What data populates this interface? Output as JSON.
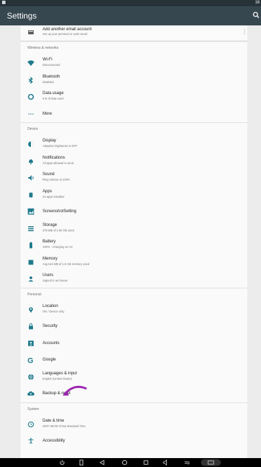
{
  "statusbar": {
    "time": "16"
  },
  "appbar": {
    "title": "Settings"
  },
  "top_item": {
    "title": "Add another email account",
    "subtitle": "Set up your personal or work email"
  },
  "sections": {
    "wireless": "Wireless & networks",
    "device": "Device",
    "personal": "Personal",
    "system": "System"
  },
  "items": {
    "wifi": {
      "title": "Wi-Fi",
      "subtitle": "Disconnected"
    },
    "bluetooth": {
      "title": "Bluetooth",
      "subtitle": "Disabled"
    },
    "data_usage": {
      "title": "Data usage",
      "subtitle": "0 B of data used"
    },
    "more": {
      "title": "More"
    },
    "display": {
      "title": "Display",
      "subtitle": "Adaptive brightness is OFF"
    },
    "notifications": {
      "title": "Notifications",
      "subtitle": "All apps allowed to send"
    },
    "sound": {
      "title": "Sound",
      "subtitle": "Ring volume at 100%"
    },
    "apps": {
      "title": "Apps",
      "subtitle": "24 apps installed"
    },
    "screenshot": {
      "title": "ScreenshotSetting"
    },
    "storage": {
      "title": "Storage",
      "subtitle": "379 MB of 4.80 GB used"
    },
    "battery": {
      "title": "Battery",
      "subtitle": "100% - Charging on AC"
    },
    "memory": {
      "title": "Memory",
      "subtitle": "Avg 513 MB of 1.9 GB memory used"
    },
    "users": {
      "title": "Users",
      "subtitle": "Signed in as Owner"
    },
    "location": {
      "title": "Location",
      "subtitle": "ON / Device only"
    },
    "security": {
      "title": "Security"
    },
    "accounts": {
      "title": "Accounts"
    },
    "google": {
      "title": "Google"
    },
    "languages": {
      "title": "Languages & input",
      "subtitle": "English (United States)"
    },
    "backup": {
      "title": "Backup & reset"
    },
    "datetime": {
      "title": "Date & time",
      "subtitle": "GMT+08:00 China Standard Time"
    },
    "accessibility": {
      "title": "Accessibility"
    }
  },
  "colors": {
    "icon": "#1f7a8c",
    "appbar": "#37474f",
    "arrow": "#9c27b0"
  }
}
